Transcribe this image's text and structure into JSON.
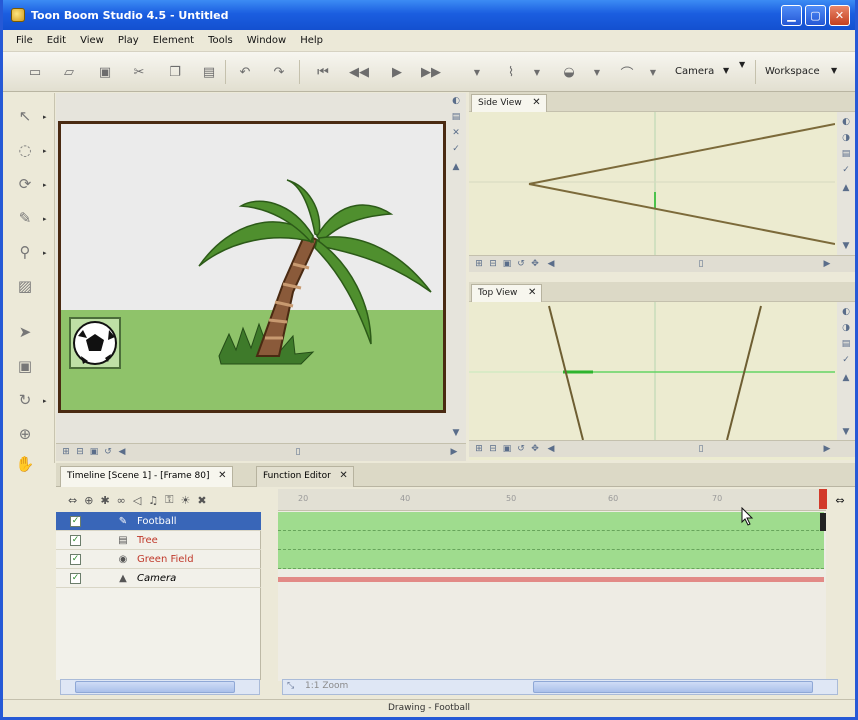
{
  "window": {
    "title": "Toon Boom Studio 4.5 - Untitled"
  },
  "menu": [
    "File",
    "Edit",
    "View",
    "Play",
    "Element",
    "Tools",
    "Window",
    "Help"
  ],
  "toolbar": {
    "camera_label": "Camera",
    "workspace_label": "Workspace"
  },
  "views": {
    "side_view": {
      "tab_label": "Side View"
    },
    "top_view": {
      "tab_label": "Top View"
    }
  },
  "timeline": {
    "tab_label": "Timeline [Scene 1] - [Frame 80]",
    "function_editor_label": "Function Editor",
    "ruler_ticks": [
      "20",
      "40",
      "50",
      "60",
      "70"
    ],
    "layers": [
      {
        "name": "Football",
        "selected": true,
        "icon": "drawing-icon"
      },
      {
        "name": "Tree",
        "selected": false,
        "icon": "drawing-icon"
      },
      {
        "name": "Green Field",
        "selected": false,
        "icon": "color-card-icon"
      },
      {
        "name": "Camera",
        "selected": false,
        "icon": "camera-icon"
      }
    ],
    "zoom_label": "1:1 Zoom"
  },
  "status": {
    "text": "Drawing - Football"
  },
  "colors": {
    "title_bar": "#1b5ee0",
    "stage_border": "#4a2a12",
    "grass": "#8fc36a",
    "track": "#9fdc8e",
    "selected_row": "#3966b8"
  }
}
